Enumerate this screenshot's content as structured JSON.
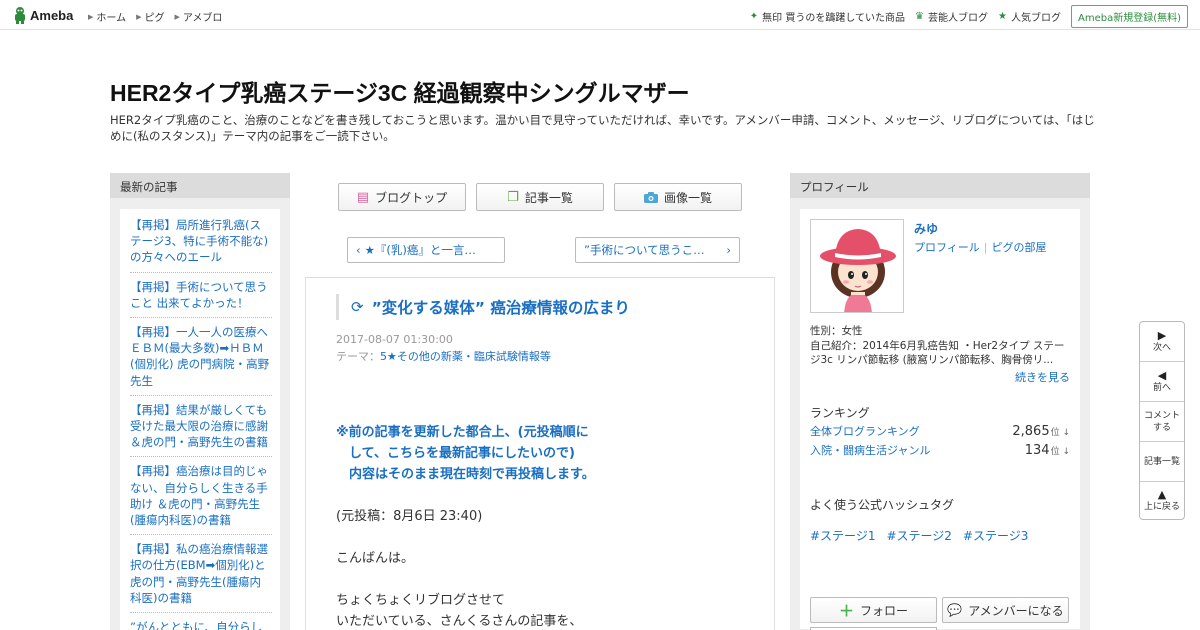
{
  "topbar": {
    "logo_text": "Ameba",
    "nav": [
      "ホーム",
      "ピグ",
      "アメブロ"
    ],
    "right_links": [
      {
        "icon": "sparkle-icon",
        "label": "無印 買うのを躊躇していた商品"
      },
      {
        "icon": "crown-icon",
        "label": "芸能人ブログ"
      },
      {
        "icon": "star-icon",
        "label": "人気ブログ"
      }
    ],
    "register_label": "Ameba新規登録(無料)"
  },
  "header": {
    "title": "HER2タイプ乳癌ステージ3C 経過観察中シングルマザー",
    "description": "HER2タイプ乳癌のこと、治療のことなどを書き残しておこうと思います。温かい目で見守っていただければ、幸いです。アメンバー申請、コメント、メッセージ、リブログについては、「はじめに(私のスタンス)」テーマ内の記事をご一読下さい。"
  },
  "left": {
    "heading": "最新の記事",
    "items": [
      "【再掲】局所進行乳癌(ステージ3、特に手術不能な)の方々へのエール",
      "【再掲】手術について思うこと 出来てよかった！",
      "【再掲】一人一人の医療へ ＥＢＭ(最大多数)➡ＨＢＭ(個別化) 虎の門病院・高野先生",
      "【再掲】結果が厳しくても受けた最大限の治療に感謝 ＆虎の門・高野先生の書籍",
      "【再掲】癌治療は目的じゃない、自分らしく生きる手助け ＆虎の門・高野先生(腫瘍内科医)の書籍",
      "【再掲】私の癌治療情報選択の仕方(EBM➡個別化)と虎の門・高野先生(腫瘍内科医)の書籍",
      "”がんとともに、自分らしく生きる ”虎の門・腫瘍内"
    ]
  },
  "center": {
    "buttons": [
      {
        "icon": "notepad-icon",
        "label": "ブログトップ"
      },
      {
        "icon": "copy-icon",
        "label": "記事一覧"
      },
      {
        "icon": "camera-icon",
        "label": "画像一覧"
      }
    ],
    "prev_label": "★『(乳)癌』と一言…",
    "next_label": "”手術について思うこ…",
    "article": {
      "title": "”変化する媒体” 癌治療情報の広まり",
      "date": "2017-08-07 01:30:00",
      "theme_prefix": "テーマ：",
      "theme": "5★その他の新薬・臨床試験情報等",
      "notice_lines": [
        "※前の記事を更新した都合上、(元投稿順に",
        "　して、こちらを最新記事にしたいので)",
        "　内容はそのまま現在時刻で再投稿します。"
      ],
      "p1": "(元投稿：8月6日 23:40)",
      "p2": "こんばんは。",
      "p3_lines": [
        "ちょくちょくリブログさせて",
        "いただいている、さんくるさんの記事を、"
      ]
    }
  },
  "right": {
    "heading": "プロフィール",
    "name": "みゆ",
    "links": [
      "プロフィール",
      "ピグの部屋"
    ],
    "gender": "性別：女性",
    "intro": "自己紹介：2014年6月乳癌告知 ・Her2タイプ ステージ3c リンパ節転移 (腋窩リンパ節転移、胸骨傍リ...",
    "more": "続きを見る",
    "ranking_heading": "ランキング",
    "rankings": [
      {
        "label": "全体ブログランキング",
        "value": "2,865",
        "unit": "位 ↓"
      },
      {
        "label": "入院・闘病生活ジャンル",
        "value": "134",
        "unit": "位 ↓"
      }
    ],
    "hashtag_heading": "よく使う公式ハッシュタグ",
    "hashtags": [
      "#ステージ1",
      "#ステージ2",
      "#ステージ3"
    ],
    "follow_label": "フォロー",
    "member_label": "アメンバーになる"
  },
  "sidenav": {
    "next": "次へ",
    "prev": "前へ",
    "comment": "コメントする",
    "list": "記事一覧",
    "top": "上に戻る"
  }
}
